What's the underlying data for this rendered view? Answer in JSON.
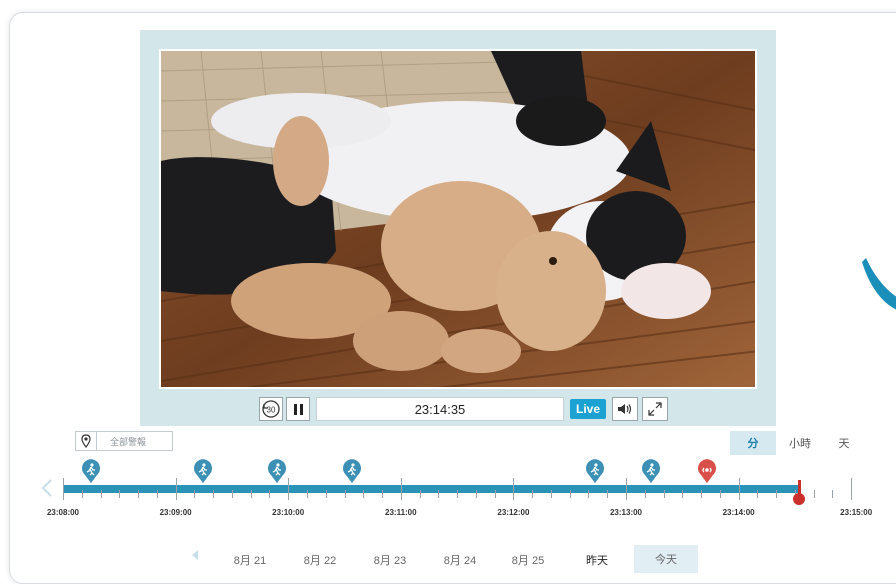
{
  "player": {
    "time": "23:14:35",
    "live_label": "Live",
    "rewind_label": "30"
  },
  "filter": {
    "label": "全部警報"
  },
  "zoom": {
    "minute": "分",
    "hour": "小時",
    "day": "天",
    "active": "minute"
  },
  "timeline": {
    "ticks": [
      "23:08:00",
      "23:09:00",
      "23:10:00",
      "23:11:00",
      "23:12:00",
      "23:13:00",
      "23:14:00",
      "23:15:00"
    ],
    "events": [
      {
        "type": "motion",
        "color": "#3c8fb5"
      },
      {
        "type": "motion",
        "color": "#3c8fb5"
      },
      {
        "type": "motion",
        "color": "#3c8fb5"
      },
      {
        "type": "motion",
        "color": "#3c8fb5"
      },
      {
        "type": "motion",
        "color": "#3c8fb5"
      },
      {
        "type": "motion",
        "color": "#3c8fb5"
      },
      {
        "type": "sound",
        "color": "#d9504a"
      }
    ],
    "playhead_color": "#c9302c",
    "track_color": "#2b93b8"
  },
  "days": {
    "items": [
      "8月 21",
      "8月 22",
      "8月 23",
      "8月 24",
      "8月 25"
    ],
    "yesterday": "昨天",
    "today": "今天"
  },
  "colors": {
    "accent": "#1ba2d3",
    "player_bg": "#d3e6ea"
  }
}
